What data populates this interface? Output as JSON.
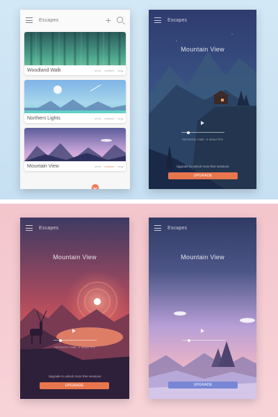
{
  "app": {
    "title": "Escapes"
  },
  "library": {
    "cards": [
      {
        "name": "Woodland Walk",
        "durations": [
          "short",
          "medium",
          "long"
        ],
        "selected": null
      },
      {
        "name": "Northern Lights",
        "durations": [
          "short",
          "medium",
          "long"
        ],
        "selected": null
      },
      {
        "name": "Mountain View",
        "durations": [
          "short",
          "medium",
          "long"
        ],
        "selected": "medium"
      }
    ]
  },
  "night_screen": {
    "title": "Mountain View",
    "session": "SESSION TIME: 5 MINUTES",
    "upsell": "Upgrade to unlock more free sessions",
    "upgrade_label": "UPGRADE"
  },
  "sunset_screen": {
    "title": "Mountain View",
    "session": "SESSION TIME: 5 MINUTES",
    "upsell": "Upgrade to unlock more free sessions",
    "upgrade_label": "UPGRADE"
  },
  "dusk_screen": {
    "title": "Mountain View",
    "upgrade_label": "UPGRADE"
  },
  "colors": {
    "accent_orange": "#e8764d",
    "accent_blue": "#7787d6",
    "top_background": "#cfe5f5",
    "bottom_background": "#f3c5cc"
  },
  "icons": [
    "menu-icon",
    "plus-icon",
    "search-icon",
    "play-icon",
    "chevron-down-icon"
  ]
}
